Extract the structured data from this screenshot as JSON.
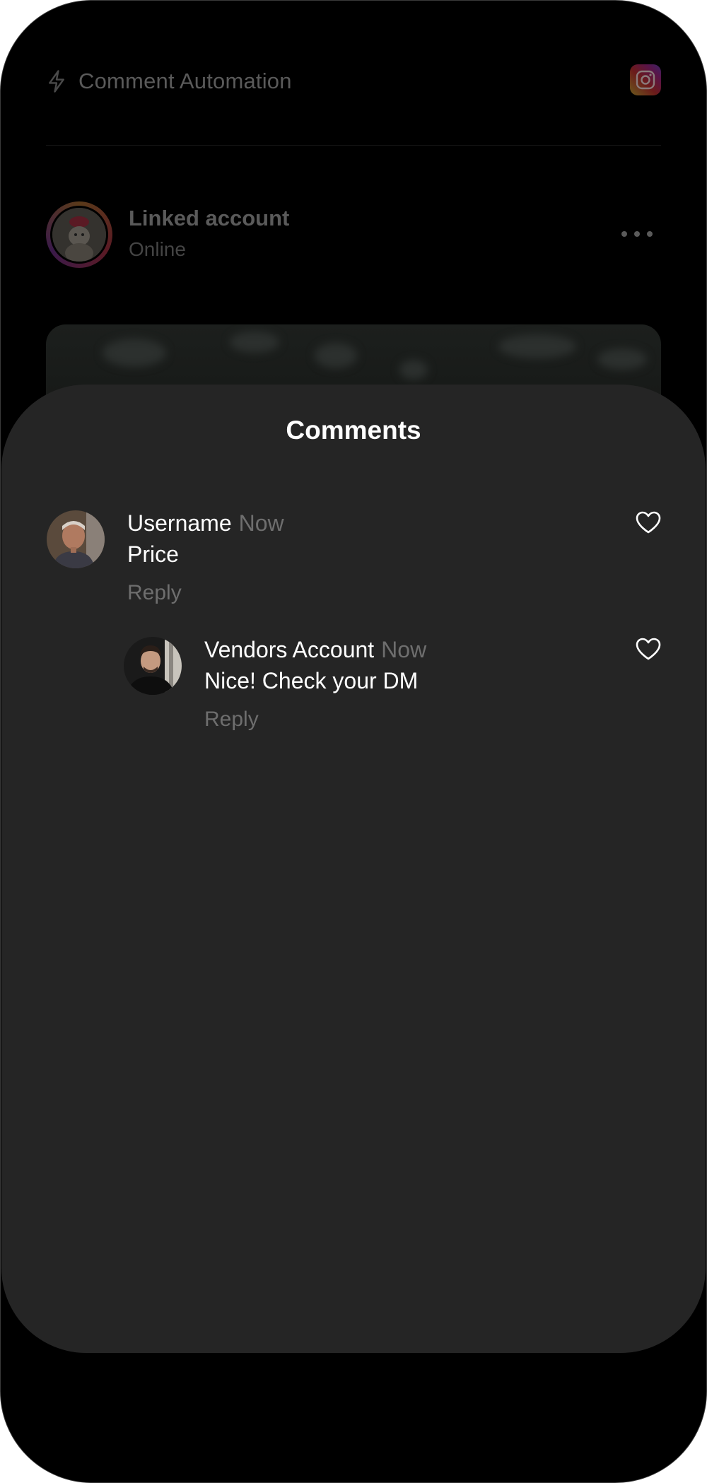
{
  "header": {
    "title": "Comment Automation",
    "bolt_icon": "bolt-icon",
    "instagram_icon": "instagram-icon"
  },
  "account": {
    "name": "Linked account",
    "status": "Online",
    "more_icon": "more-horizontal-icon"
  },
  "comments_sheet": {
    "title": "Comments",
    "comments": [
      {
        "username": "Username",
        "time": "Now",
        "text": "Price",
        "reply_label": "Reply",
        "like_icon": "heart-icon"
      },
      {
        "username": "Vendors Account",
        "time": "Now",
        "text": "Nice! Check your DM",
        "reply_label": "Reply",
        "like_icon": "heart-icon"
      }
    ]
  },
  "colors": {
    "background": "#000000",
    "sheet": "#252525",
    "text_primary": "#ffffff",
    "text_secondary": "#6e6e6e",
    "dimmed_text": "#5a5a5a"
  }
}
